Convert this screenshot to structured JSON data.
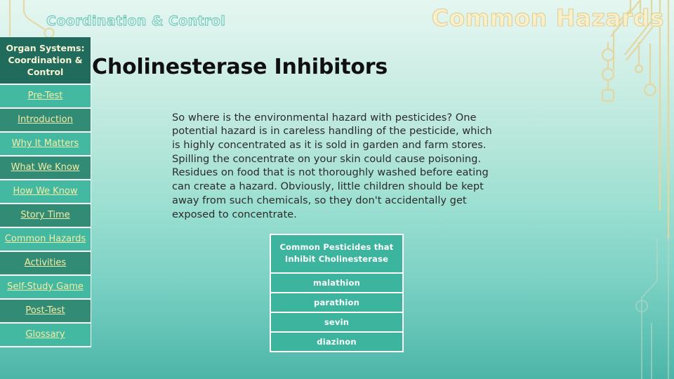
{
  "header": {
    "kicker": "Coordination & Control",
    "deck_title": "Common Hazards",
    "slide_title": "Cholinesterase Inhibitors"
  },
  "sidebar": {
    "heading": "Organ Systems: Coordination & Control",
    "items": [
      {
        "label": "Pre-Test",
        "shade": "light"
      },
      {
        "label": "Introduction",
        "shade": "dark"
      },
      {
        "label": "Why It Matters",
        "shade": "light"
      },
      {
        "label": "What We Know",
        "shade": "dark"
      },
      {
        "label": "How We Know",
        "shade": "light"
      },
      {
        "label": "Story Time",
        "shade": "dark"
      },
      {
        "label": "Common Hazards",
        "shade": "light"
      },
      {
        "label": "Activities",
        "shade": "dark"
      },
      {
        "label": "Self-Study Game",
        "shade": "light"
      },
      {
        "label": "Post-Test",
        "shade": "dark"
      },
      {
        "label": "Glossary",
        "shade": "light"
      }
    ]
  },
  "main": {
    "body_text": "So where is the environmental hazard with pesticides? One potential hazard is in careless handling of the pesticide, which is highly concentrated as it is sold in garden and farm stores. Spilling the concentrate on your skin could cause poisoning. Residues on food that is not thoroughly washed before eating can create a hazard. Obviously, little children should be kept away from such chemicals, so they don't accidentally get exposed to concentrate."
  },
  "pesticide_table": {
    "header": "Common Pesticides that Inhibit Cholinesterase",
    "rows": [
      "malathion",
      "parathion",
      "sevin",
      "diazinon"
    ]
  },
  "colors": {
    "background_top": "#e4f6f0",
    "background_bottom": "#4cb5a8",
    "nav_heading_bg": "#206b5c",
    "nav_light_bg": "#44b9a2",
    "nav_dark_bg": "#318b75",
    "nav_link_text": "#f2eda6",
    "table_cell_bg": "#3cb49e",
    "deck_title_text": "#f6f0cf",
    "kicker_text": "#d9f3ee",
    "circuit_trace": "#e3d6a0"
  }
}
